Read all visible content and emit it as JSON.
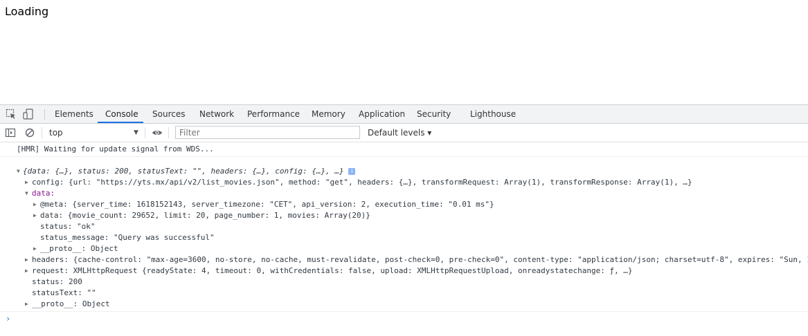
{
  "page": {
    "loading_text": "Loading"
  },
  "devtools": {
    "tabs": [
      "Elements",
      "Console",
      "Sources",
      "Network",
      "Performance",
      "Memory",
      "Application",
      "Security",
      "Lighthouse"
    ],
    "active_tab": "Console",
    "context": "top",
    "filter_placeholder": "Filter",
    "levels_label": "Default levels ▾",
    "accent": "#1a73e8"
  },
  "console": {
    "hmr": "[HMR] Waiting for update signal from WDS...",
    "object_summary": "{data: {…}, status: 200, statusText: \"\", headers: {…}, config: {…}, …}",
    "config_line": "config: {url: \"https://yts.mx/api/v2/list_movies.json\", method: \"get\", headers: {…}, transformRequest: Array(1), transformResponse: Array(1), …}",
    "data_label": "data:",
    "meta_line": "@meta: {server_time: 1618152143, server_timezone: \"CET\", api_version: 2, execution_time: \"0.01 ms\"}",
    "data_inner_line": "data: {movie_count: 29652, limit: 20, page_number: 1, movies: Array(20)}",
    "status_ok_line": "status: \"ok\"",
    "status_message_line": "status_message: \"Query was successful\"",
    "proto_inner": "__proto__: Object",
    "headers_line": "headers: {cache-control: \"max-age=3600, no-store, no-cache, must-revalidate, post-check=0, pre-check=0\", content-type: \"application/json; charset=utf-8\", expires: \"Sun, 1",
    "request_line": "request: XMLHttpRequest {readyState: 4, timeout: 0, withCredentials: false, upload: XMLHttpRequestUpload, onreadystatechange: ƒ, …}",
    "status_line": "status: 200",
    "statusText_line": "statusText: \"\"",
    "proto_outer": "__proto__: Object"
  }
}
